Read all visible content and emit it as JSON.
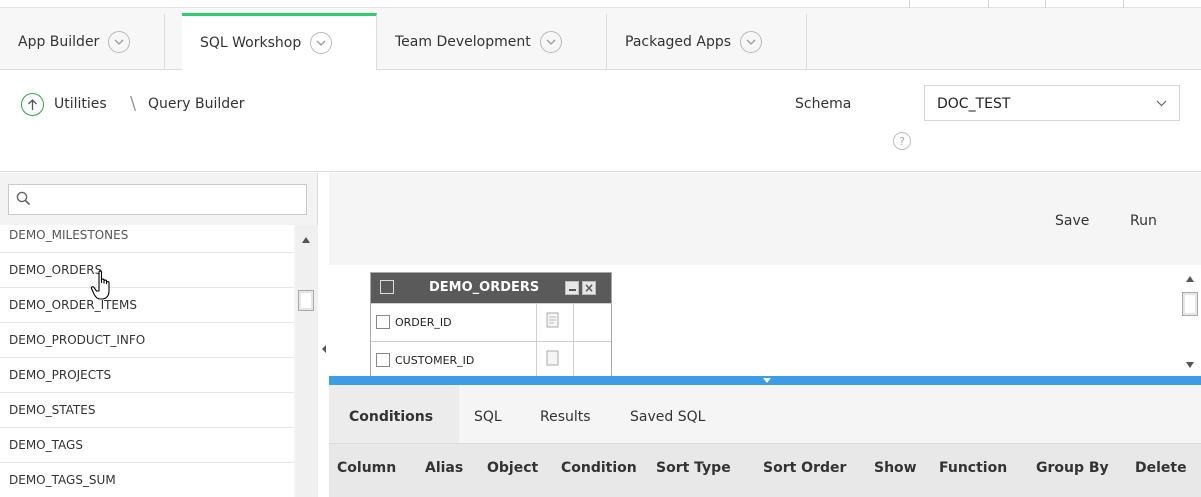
{
  "tabs": [
    {
      "label": "App Builder"
    },
    {
      "label": "SQL Workshop"
    },
    {
      "label": "Team Development"
    },
    {
      "label": "Packaged Apps"
    }
  ],
  "breadcrumb": {
    "parent": "Utilities",
    "current": "Query Builder"
  },
  "schema": {
    "label": "Schema",
    "value": "DOC_TEST"
  },
  "search": {
    "placeholder": ""
  },
  "object_list": [
    "DEMO_MILESTONES",
    "DEMO_ORDERS",
    "DEMO_ORDER_ITEMS",
    "DEMO_PRODUCT_INFO",
    "DEMO_PROJECTS",
    "DEMO_STATES",
    "DEMO_TAGS",
    "DEMO_TAGS_SUM"
  ],
  "toolbar": {
    "save_label": "Save",
    "run_label": "Run"
  },
  "table_card": {
    "title": "DEMO_ORDERS",
    "columns": [
      "ORDER_ID",
      "CUSTOMER_ID"
    ]
  },
  "bottom_tabs": [
    "Conditions",
    "SQL",
    "Results",
    "Saved SQL"
  ],
  "condition_columns": [
    "Column",
    "Alias",
    "Object",
    "Condition",
    "Sort Type",
    "Sort Order",
    "Show",
    "Function",
    "Group By",
    "Delete"
  ],
  "colors": {
    "active_tab": "#2ecb71",
    "splitter": "#3c9de6",
    "table_header": "#5a5a5a"
  }
}
